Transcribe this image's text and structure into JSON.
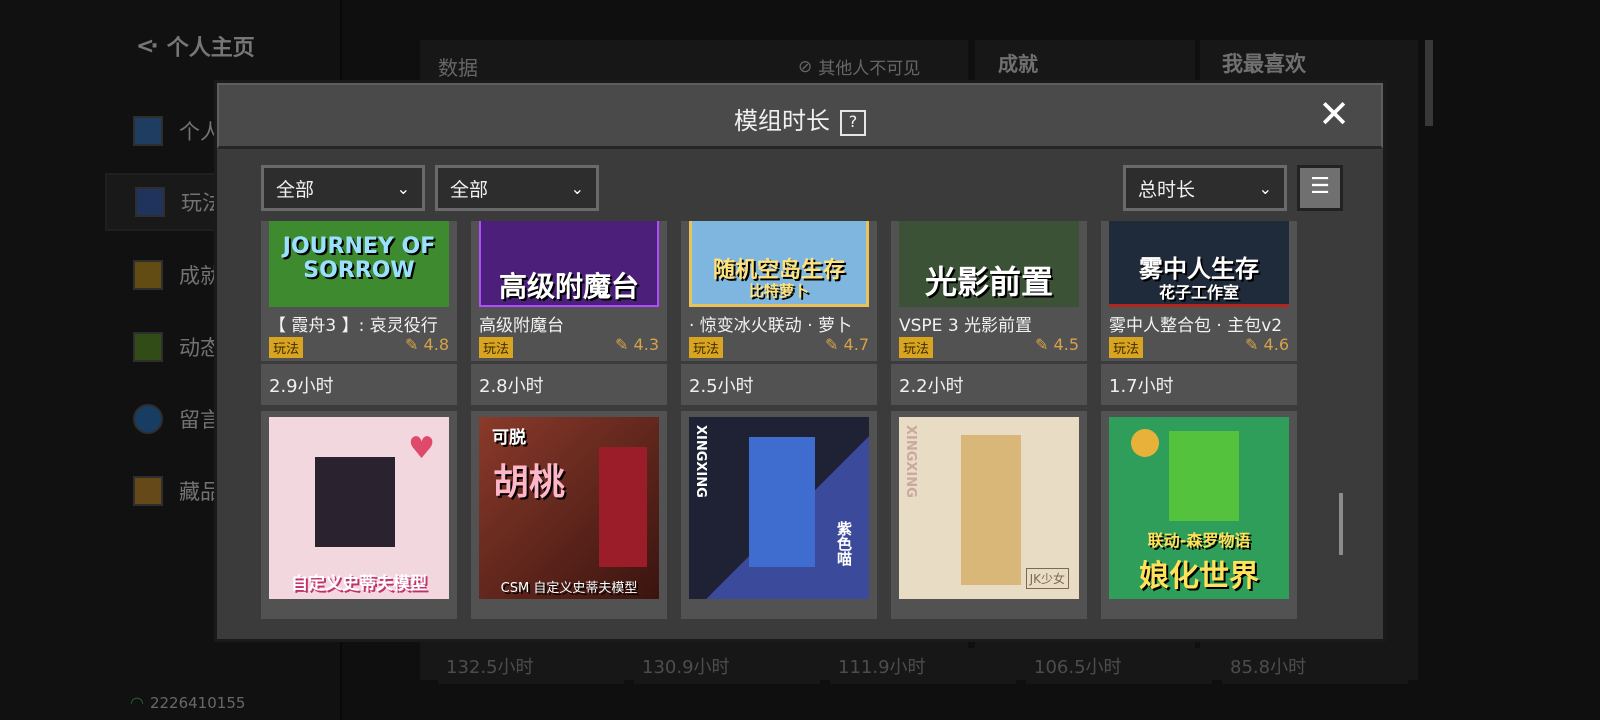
{
  "background": {
    "back_label": "个人主页",
    "sidebar_items": [
      {
        "label": "个人",
        "icon": "profile-icon"
      },
      {
        "label": "玩法",
        "icon": "grid-icon"
      },
      {
        "label": "成就",
        "icon": "trophy-icon"
      },
      {
        "label": "动态",
        "icon": "activity-icon"
      },
      {
        "label": "留言",
        "icon": "message-icon"
      },
      {
        "label": "藏品",
        "icon": "chest-icon"
      }
    ],
    "user_id": "2226410155",
    "data_title": "数据",
    "private_label": "其他人不可见",
    "achievements_title": "成就",
    "favorites_title": "我最喜欢",
    "hours": [
      "132.5小时",
      "130.9小时",
      "111.9小时",
      "106.5小时",
      "85.8小时"
    ]
  },
  "modal": {
    "title": "模组时长",
    "help_glyph": "?",
    "close_glyph": "✕",
    "filter1": "全部",
    "filter2": "全部",
    "sort": "总时长",
    "sort_icon": "sort-icon"
  },
  "cards_row1": [
    {
      "name": "【 霞舟3 】: 哀灵役行",
      "tag": "玩法",
      "rating": "4.8",
      "hours": "2.9小时",
      "thumb_text": "JOURNEY OF SORROW",
      "color": "#3d8b2e"
    },
    {
      "name": "高级附魔台",
      "tag": "玩法",
      "rating": "4.3",
      "hours": "2.8小时",
      "thumb_text": "高级附魔台",
      "color": "#4b1f7a"
    },
    {
      "name": "· 惊变冰火联动 · 萝卜",
      "tag": "玩法",
      "rating": "4.7",
      "hours": "2.5小时",
      "thumb_text": "随机空岛生存",
      "thumb_sub": "比特萝卜",
      "color": "#7fb6e0"
    },
    {
      "name": "VSPE 3 光影前置",
      "tag": "玩法",
      "rating": "4.5",
      "hours": "2.2小时",
      "thumb_text": "光影前置",
      "color": "#3c5236"
    },
    {
      "name": "雾中人整合包 · 主包v2",
      "tag": "玩法",
      "rating": "4.6",
      "hours": "1.7小时",
      "thumb_text": "雾中人生存",
      "thumb_sub": "花子工作室",
      "color": "#1f2a3a"
    }
  ],
  "cards_row2": [
    {
      "thumb_text": "自定义史蒂夫模型",
      "color": "#f3d7de"
    },
    {
      "thumb_text": "胡桃",
      "thumb_sub": "CSM 自定义史蒂夫模型",
      "thumb_top": "可脱",
      "color": "#6b2a1f"
    },
    {
      "thumb_text": "紫色喵",
      "thumb_side": "XINGXING",
      "color": "#24293f"
    },
    {
      "thumb_text": "JK少女",
      "thumb_side": "XINGXING",
      "color": "#e9dcc4"
    },
    {
      "thumb_text": "娘化世界",
      "thumb_sub": "联动-森罗物语",
      "color": "#2f9e5a"
    }
  ]
}
